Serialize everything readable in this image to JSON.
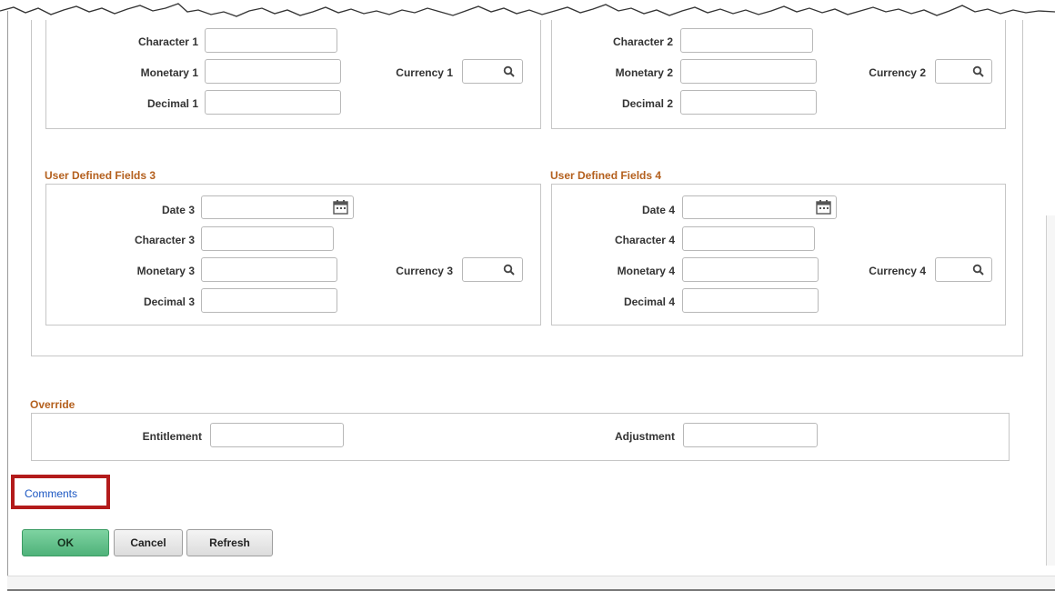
{
  "udf1": {
    "character_label": "Character 1",
    "monetary_label": "Monetary 1",
    "currency_label": "Currency 1",
    "decimal_label": "Decimal 1"
  },
  "udf2": {
    "character_label": "Character 2",
    "monetary_label": "Monetary 2",
    "currency_label": "Currency 2",
    "decimal_label": "Decimal 2"
  },
  "udf3": {
    "title": "User Defined Fields 3",
    "date_label": "Date 3",
    "character_label": "Character 3",
    "monetary_label": "Monetary 3",
    "currency_label": "Currency 3",
    "decimal_label": "Decimal 3"
  },
  "udf4": {
    "title": "User Defined Fields 4",
    "date_label": "Date 4",
    "character_label": "Character 4",
    "monetary_label": "Monetary 4",
    "currency_label": "Currency 4",
    "decimal_label": "Decimal 4"
  },
  "override": {
    "title": "Override",
    "entitlement_label": "Entitlement",
    "adjustment_label": "Adjustment"
  },
  "links": {
    "comments": "Comments"
  },
  "buttons": {
    "ok": "OK",
    "cancel": "Cancel",
    "refresh": "Refresh"
  },
  "colors": {
    "section_title": "#b4601e",
    "link": "#1a56c2",
    "highlight": "#b31b1b",
    "ok_button": "#5cbf86"
  },
  "icons": {
    "lookup": "magnifier-icon",
    "date": "calendar-icon"
  }
}
